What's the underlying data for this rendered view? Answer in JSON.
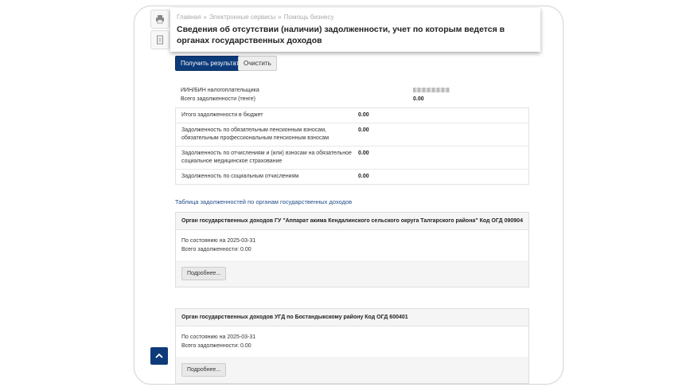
{
  "breadcrumb": [
    "Главная",
    "Электронные сервисы",
    "Помощь бизнесу"
  ],
  "breadcrumb_sep": "»",
  "page_title": "Сведения об отсутствии (наличии) задолженности, учет по которым ведется в органах государственных доходов",
  "buttons": {
    "get_result": "Получить результат",
    "clear": "Очистить",
    "more": "Подробнее..."
  },
  "summary": {
    "iin_label": "ИИН/БИН налогоплательщика",
    "total_label": "Всего задолженности (тенге)",
    "total_value": "0.00"
  },
  "debts": [
    {
      "label": "Итого задолженности в бюджет",
      "value": "0.00"
    },
    {
      "label": "Задолженность по обязательным пенсионным взносам, обязательным профессиональным пенсионным взносам",
      "value": "0.00"
    },
    {
      "label": "Задолженность по отчислениям и (или) взносам на обязательное социальное медицинское страхование",
      "value": "0.00"
    },
    {
      "label": "Задолженность по социальным отчислениям",
      "value": "0.00"
    }
  ],
  "table_link": "Таблица задолженностей по органам государственных доходов",
  "orgs": [
    {
      "title": "Орган государственных доходов ГУ \"Аппарат акима Кендалинского сельского округа Талгарского района\" Код ОГД 090904",
      "as_of": "По состоянию на 2025-03-31",
      "total": "Всего задолженности: 0.00"
    },
    {
      "title": "Орган государственных доходов УГД по Бостандыкскому району Код ОГД 600401",
      "as_of": "По состоянию на 2025-03-31",
      "total": "Всего задолженности: 0.00"
    }
  ],
  "icons": {
    "print": "print-icon",
    "pdf": "document-icon",
    "scroll_top": "chevron-up-icon"
  },
  "colors": {
    "primary": "#0d3b7a"
  }
}
